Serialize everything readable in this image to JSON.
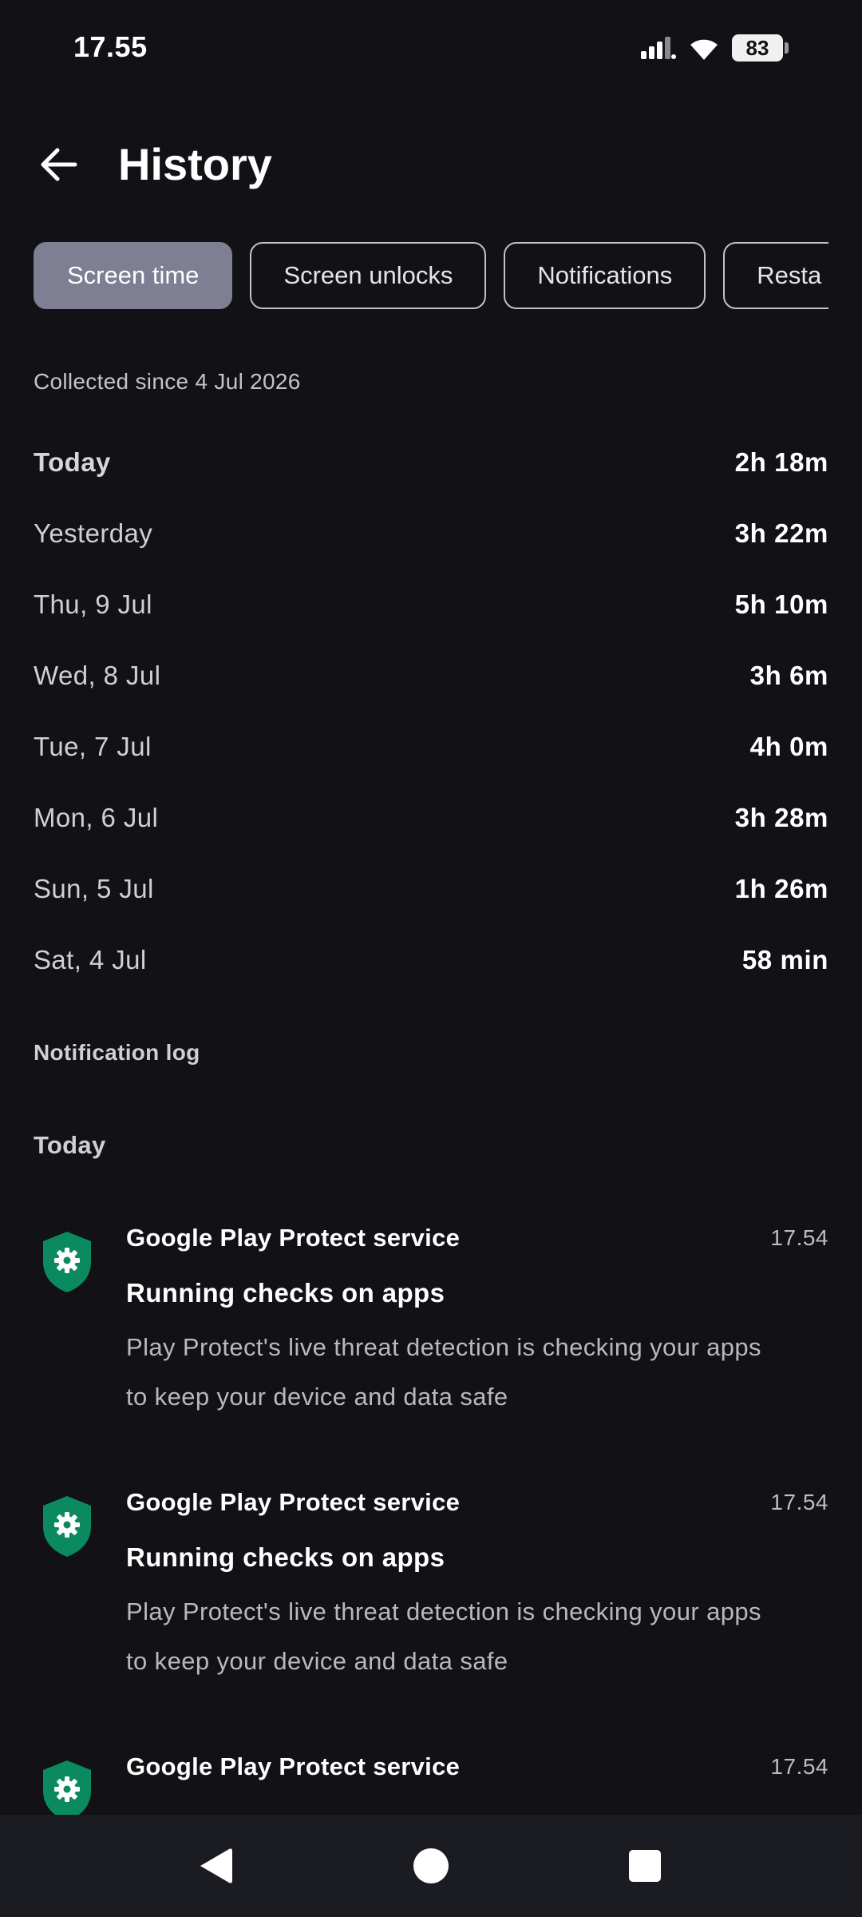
{
  "status_bar": {
    "time": "17.55",
    "battery": "83",
    "icons": [
      "signal-icon",
      "wifi-icon",
      "battery-icon"
    ]
  },
  "header": {
    "title": "History",
    "back_icon": "arrow-left-icon"
  },
  "tabs": [
    {
      "label": "Screen time",
      "active": true
    },
    {
      "label": "Screen unlocks",
      "active": false
    },
    {
      "label": "Notifications",
      "active": false
    },
    {
      "label": "Resta",
      "active": false
    }
  ],
  "collected_since": "Collected since 4 Jul 2026",
  "history": [
    {
      "day": "Today",
      "duration": "2h 18m"
    },
    {
      "day": "Yesterday",
      "duration": "3h 22m"
    },
    {
      "day": "Thu, 9 Jul",
      "duration": "5h 10m"
    },
    {
      "day": "Wed, 8 Jul",
      "duration": "3h 6m"
    },
    {
      "day": "Tue, 7 Jul",
      "duration": "4h 0m"
    },
    {
      "day": "Mon, 6 Jul",
      "duration": "3h 28m"
    },
    {
      "day": "Sun, 5 Jul",
      "duration": "1h 26m"
    },
    {
      "day": "Sat, 4 Jul",
      "duration": "58 min"
    }
  ],
  "notification_log": {
    "label": "Notification log",
    "group_label": "Today",
    "items": [
      {
        "app": "Google Play Protect service",
        "time": "17.54",
        "title": "Running checks on apps",
        "body_line1": "Play Protect's live threat detection is checking your apps",
        "body_line2": "to keep your device and data safe",
        "icon": "shield-gear-icon"
      },
      {
        "app": "Google Play Protect service",
        "time": "17.54",
        "title": "Running checks on apps",
        "body_line1": "Play Protect's live threat detection is checking your apps",
        "body_line2": "to keep your device and data safe",
        "icon": "shield-gear-icon"
      },
      {
        "app": "Google Play Protect service",
        "time": "17.54",
        "icon": "shield-gear-icon"
      }
    ]
  },
  "colors": {
    "background": "#111116",
    "active_tab": "#7e7f93",
    "shield": "#0b8a5f",
    "nav_bar": "#1b1c21"
  },
  "nav_bar": {
    "buttons": [
      "back-triangle-icon",
      "home-circle-icon",
      "recents-square-icon"
    ]
  }
}
